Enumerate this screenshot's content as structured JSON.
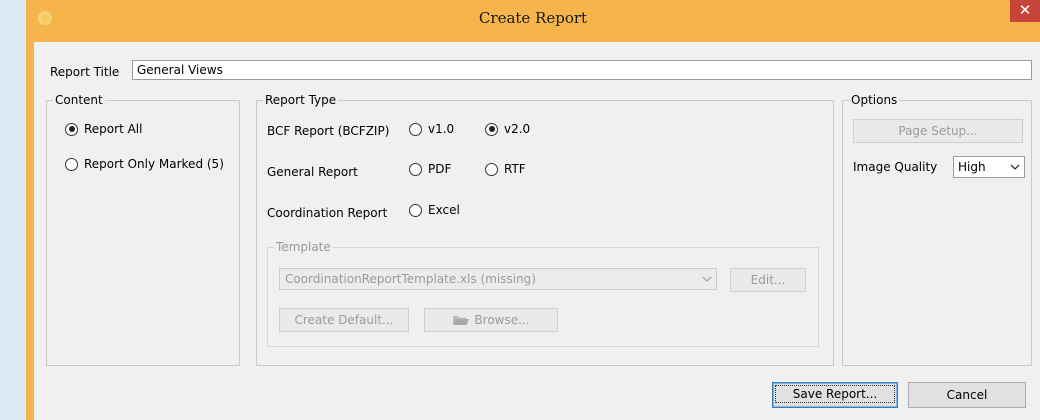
{
  "dialog": {
    "title": "Create Report",
    "close_glyph": "✕"
  },
  "report_title": {
    "label": "Report Title",
    "value": "General Views"
  },
  "content": {
    "group_title": "Content",
    "options": [
      {
        "label": "Report All",
        "selected": true
      },
      {
        "label": "Report Only Marked (5)",
        "selected": false
      }
    ]
  },
  "report_type": {
    "group_title": "Report Type",
    "rows": [
      {
        "label": "BCF Report (BCFZIP)",
        "options": [
          {
            "label": "v1.0",
            "selected": false
          },
          {
            "label": "v2.0",
            "selected": true
          }
        ]
      },
      {
        "label": "General Report",
        "options": [
          {
            "label": "PDF",
            "selected": false
          },
          {
            "label": "RTF",
            "selected": false
          }
        ]
      },
      {
        "label": "Coordination Report",
        "options": [
          {
            "label": "Excel",
            "selected": false
          }
        ]
      }
    ],
    "template": {
      "group_title": "Template",
      "selected": "CoordinationReportTemplate.xls (missing)",
      "edit_label": "Edit...",
      "create_default_label": "Create Default...",
      "browse_label": "Browse..."
    }
  },
  "options": {
    "group_title": "Options",
    "page_setup_label": "Page Setup...",
    "image_quality_label": "Image Quality",
    "image_quality_value": "High"
  },
  "footer": {
    "save_label": "Save Report...",
    "cancel_label": "Cancel"
  },
  "colors": {
    "frame": "#f5b54a",
    "close_button": "#c8433a",
    "client": "#f0f0f0",
    "desktop": "#dce9f5"
  },
  "icons": {
    "app": "app-icon",
    "close": "close-icon",
    "dropdown": "chevron-down-icon",
    "folder": "folder-icon"
  }
}
